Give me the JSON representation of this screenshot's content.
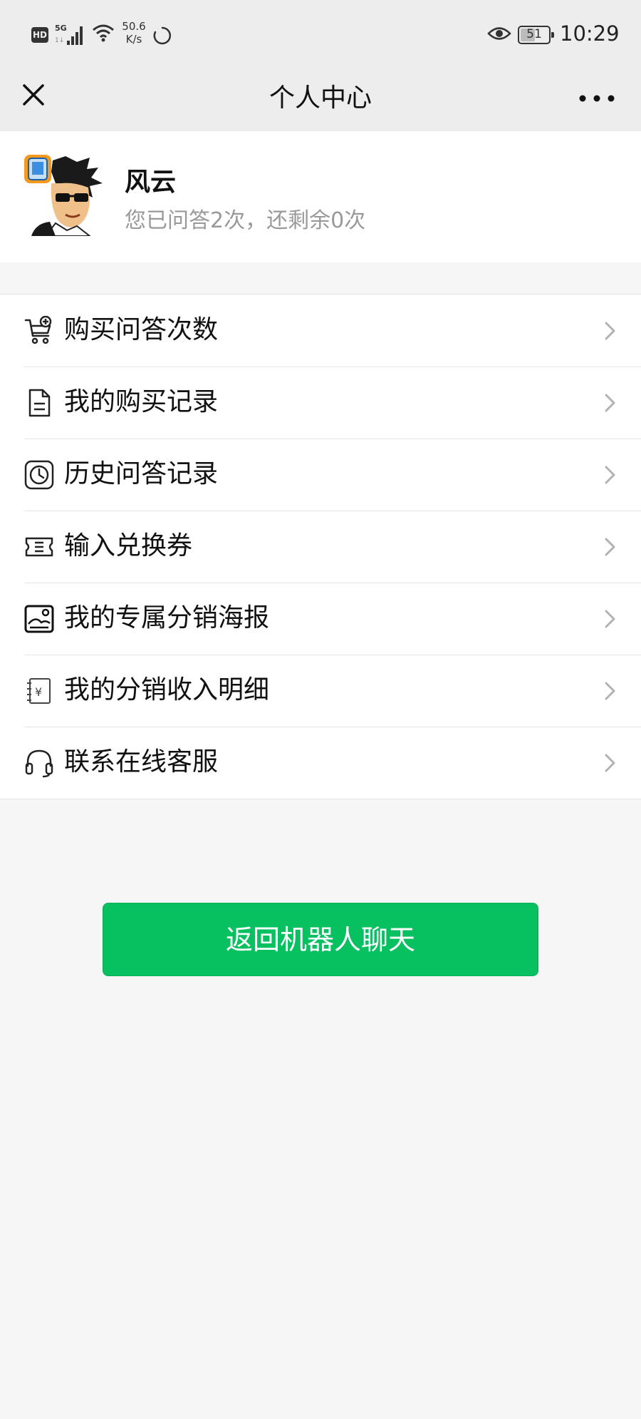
{
  "status_bar": {
    "hd_badge": "HD",
    "network": "5G",
    "speed_value": "50.6",
    "speed_unit": "K/s",
    "battery_level": "51",
    "time": "10:29"
  },
  "nav": {
    "title": "个人中心",
    "close_icon": "close-icon",
    "more_icon": "more-icon"
  },
  "profile": {
    "name": "风云",
    "subtitle": "您已问答2次，还剩余0次"
  },
  "menu": {
    "items": [
      {
        "label": "购买问答次数",
        "icon": "cart-plus-icon"
      },
      {
        "label": "我的购买记录",
        "icon": "document-icon"
      },
      {
        "label": "历史问答记录",
        "icon": "clock-icon"
      },
      {
        "label": "输入兑换券",
        "icon": "ticket-icon"
      },
      {
        "label": "我的专属分销海报",
        "icon": "poster-image-icon"
      },
      {
        "label": "我的分销收入明细",
        "icon": "income-ledger-icon"
      },
      {
        "label": "联系在线客服",
        "icon": "headset-icon"
      }
    ]
  },
  "primary_button": {
    "label": "返回机器人聊天"
  },
  "colors": {
    "accent_green": "#07c160",
    "header_bg": "#ededed",
    "page_bg": "#f6f6f6",
    "muted_text": "#999999"
  }
}
